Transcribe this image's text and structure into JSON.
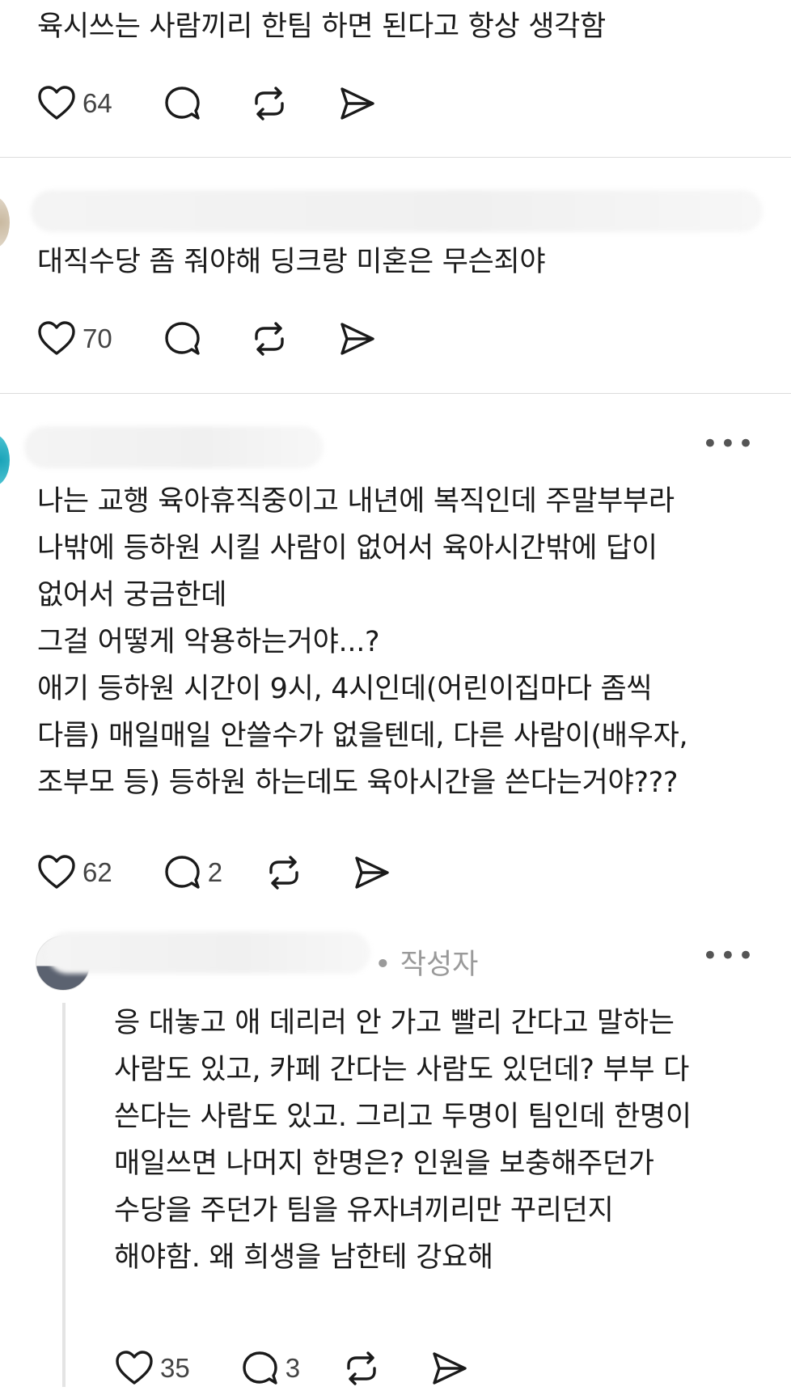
{
  "posts": [
    {
      "text": "육시쓰는 사람끼리 한팀 하면 된다고 항상 생각함",
      "likes": "64",
      "replies": ""
    },
    {
      "text": "대직수당 좀 줘야해 딩크랑 미혼은 무슨죄야",
      "likes": "70",
      "replies": ""
    },
    {
      "text": "나는 교행 육아휴직중이고 내년에 복직인데 주말부부라\n나밖에 등하원 시킬 사람이 없어서 육아시간밖에 답이\n없어서 궁금한데\n그걸 어떻게 악용하는거야...?\n애기 등하원 시간이 9시, 4시인데(어린이집마다 좀씩\n다름) 매일매일 안쓸수가 없을텐데, 다른 사람이(배우자,\n조부모 등) 등하원 하는데도 육아시간을 쓴다는거야???",
      "likes": "62",
      "replies": "2"
    },
    {
      "author_tag": "• 작성자",
      "text": "응 대놓고 애 데리러 안 가고 빨리 간다고 말하는\n사람도 있고, 카페 간다는 사람도 있던데? 부부 다\n쓴다는 사람도 있고. 그리고 두명이 팀인데 한명이\n매일쓰면 나머지 한명은? 인원을 보충해주던가\n수당을 주던가 팀을 유자녀끼리만 꾸리던지\n해야함. 왜 희생을 남한테 강요해",
      "likes": "35",
      "replies": "3"
    }
  ],
  "icons": {
    "like": "heart-icon",
    "reply": "comment-bubble-icon",
    "repost": "repost-icon",
    "share": "send-icon",
    "more": "more-dots-icon"
  },
  "more_label": "•••",
  "colors": {
    "icon": "#1a1a1a",
    "divider": "#dcdcdc",
    "muted": "#9a9a9a"
  }
}
